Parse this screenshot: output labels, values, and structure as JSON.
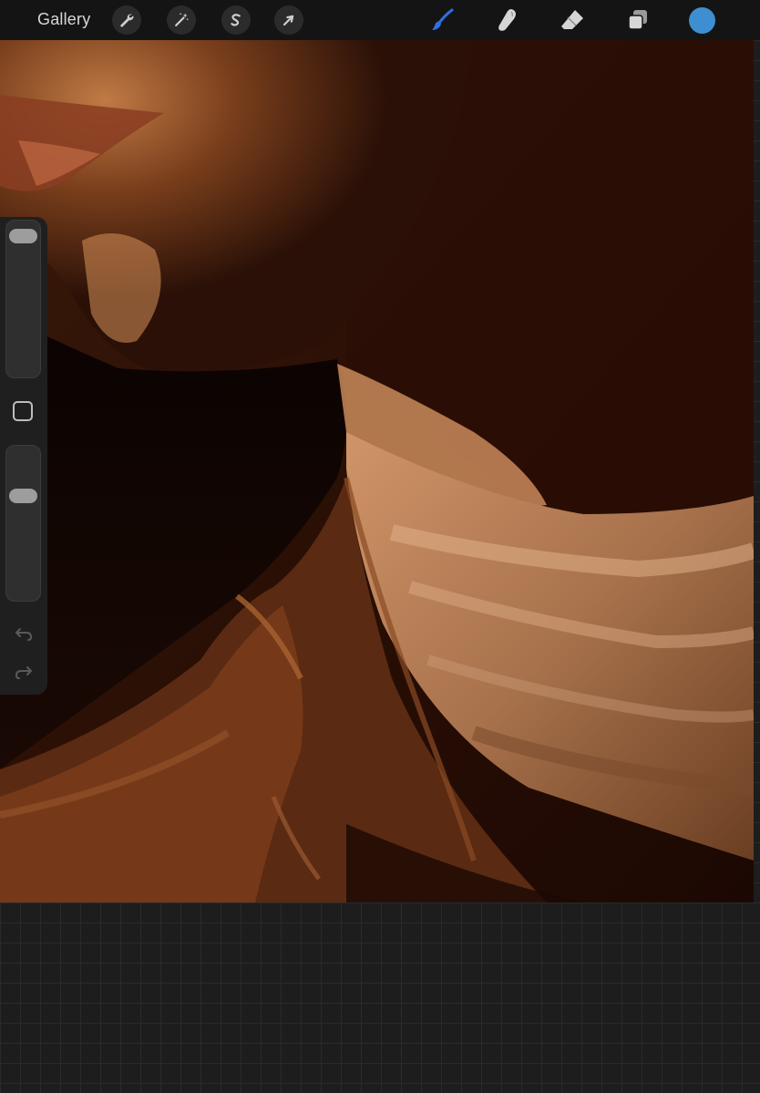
{
  "topbar": {
    "gallery_label": "Gallery",
    "left_tools": [
      {
        "name": "actions",
        "icon": "wrench-icon"
      },
      {
        "name": "adjustments",
        "icon": "magic-wand-icon"
      },
      {
        "name": "selection",
        "icon": "selection-s-icon"
      },
      {
        "name": "transform",
        "icon": "arrow-cursor-icon"
      }
    ],
    "right_tools": [
      {
        "name": "brush",
        "icon": "brush-icon",
        "active": true
      },
      {
        "name": "smudge",
        "icon": "smudge-finger-icon",
        "active": false
      },
      {
        "name": "eraser",
        "icon": "eraser-icon",
        "active": false
      },
      {
        "name": "layers",
        "icon": "layers-icon",
        "active": false
      }
    ],
    "current_color": "#3d8fd1",
    "active_tool_color": "#2f6fe0"
  },
  "sidebar": {
    "brush_size_level": 0.04,
    "opacity_level": 0.3,
    "modify_icon": "square-outline-icon",
    "undo_icon": "undo-arrow-icon",
    "redo_icon": "redo-arrow-icon"
  },
  "canvas": {
    "subject": "painted-portrait-neck-and-collar",
    "palette": [
      "#1a0904",
      "#6b3416",
      "#a45f2e",
      "#c98a5a",
      "#e0b08a",
      "#050201"
    ]
  }
}
